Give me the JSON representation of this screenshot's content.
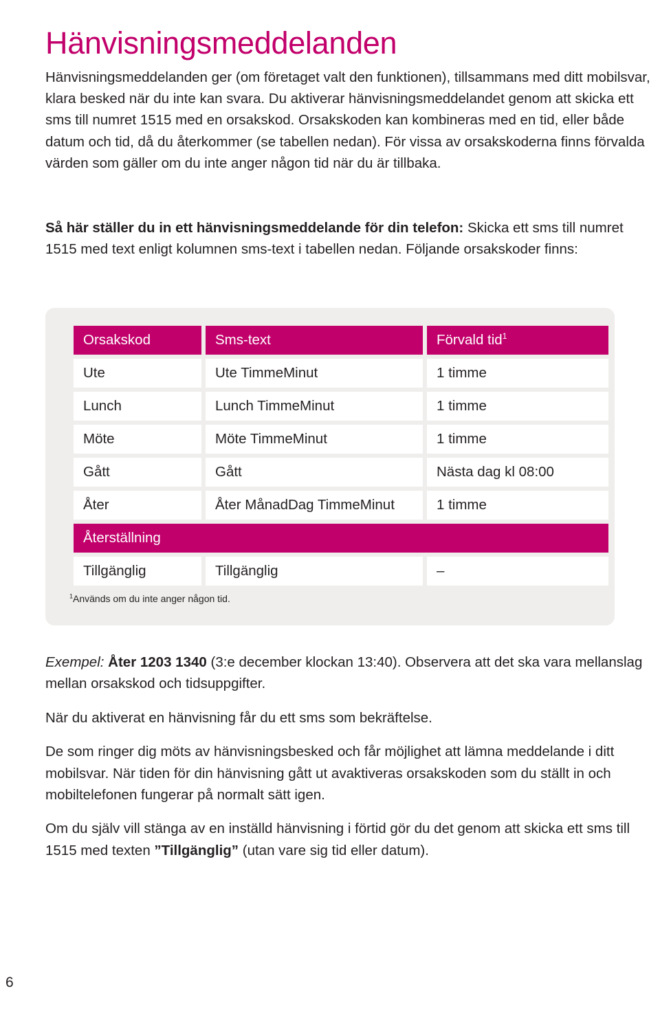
{
  "page": {
    "number": "6",
    "accent_color": "#c2006b",
    "panel_bg": "#efeeec",
    "text_color": "#231f20"
  },
  "title": "Hänvisningsmeddelanden",
  "intro": "Hänvisningsmeddelanden ger (om företaget valt den funktionen), tillsammans med ditt mobilsvar, klara besked när du inte kan svara. Du aktiverar hänvisningsmeddelandet genom att skicka ett sms till numret 1515 med en orsakskod. Orsakskoden kan kombineras med en tid, eller både datum och tid, då du återkommer (se tabellen nedan). För vissa av orsakskoderna finns förvalda värden som gäller om du inte anger någon tid när du är tillbaka.",
  "howto": {
    "heading": "Så här ställer du in ett hänvisningsmeddelande för din telefon:",
    "body": "Skicka ett sms till numret 1515 med text enligt kolumnen sms-text i tabellen nedan. Följande orsakskoder finns:"
  },
  "table": {
    "headers": [
      "Orsakskod",
      "Sms-text",
      "Förvald tid"
    ],
    "header_footnote_marker": "1",
    "rows": [
      {
        "type": "data",
        "cells": [
          "Ute",
          "Ute TimmeMinut",
          "1 timme"
        ]
      },
      {
        "type": "data",
        "cells": [
          "Lunch",
          "Lunch TimmeMinut",
          "1 timme"
        ]
      },
      {
        "type": "data",
        "cells": [
          "Möte",
          "Möte TimmeMinut",
          "1 timme"
        ]
      },
      {
        "type": "data",
        "cells": [
          "Gått",
          "Gått",
          "Nästa dag kl 08:00"
        ]
      },
      {
        "type": "data",
        "cells": [
          "Åter",
          "Åter MånadDag TimmeMinut",
          "1 timme"
        ]
      },
      {
        "type": "section",
        "label": "Återställning"
      },
      {
        "type": "data",
        "cells": [
          "Tillgänglig",
          "Tillgänglig",
          "–"
        ]
      }
    ],
    "footnote": {
      "marker": "1",
      "text": "Används om du inte anger någon tid."
    }
  },
  "after": {
    "example": {
      "label": "Exempel:",
      "code": "Åter 1203 1340",
      "rest": "(3:e december klockan 13:40). Observera att det ska vara mellanslag mellan orsakskod och tidsuppgifter."
    },
    "p_confirmation": "När du aktiverat en hänvisning får du ett sms som bekräftelse.",
    "p_callers": "De som ringer dig möts av hänvisningsbesked och får möjlighet att lämna meddelande i ditt mobilsvar. När tiden för din hänvisning gått ut avaktiveras orsakskoden som du ställt in och mobiltelefonen fungerar på normalt sätt igen.",
    "p_turnoff": {
      "pre": "Om du själv vill stänga av en inställd hänvisning i förtid gör du det genom att skicka ett sms till 1515 med texten ",
      "code": "”Tillgänglig”",
      "post": " (utan vare sig tid eller datum)."
    }
  }
}
